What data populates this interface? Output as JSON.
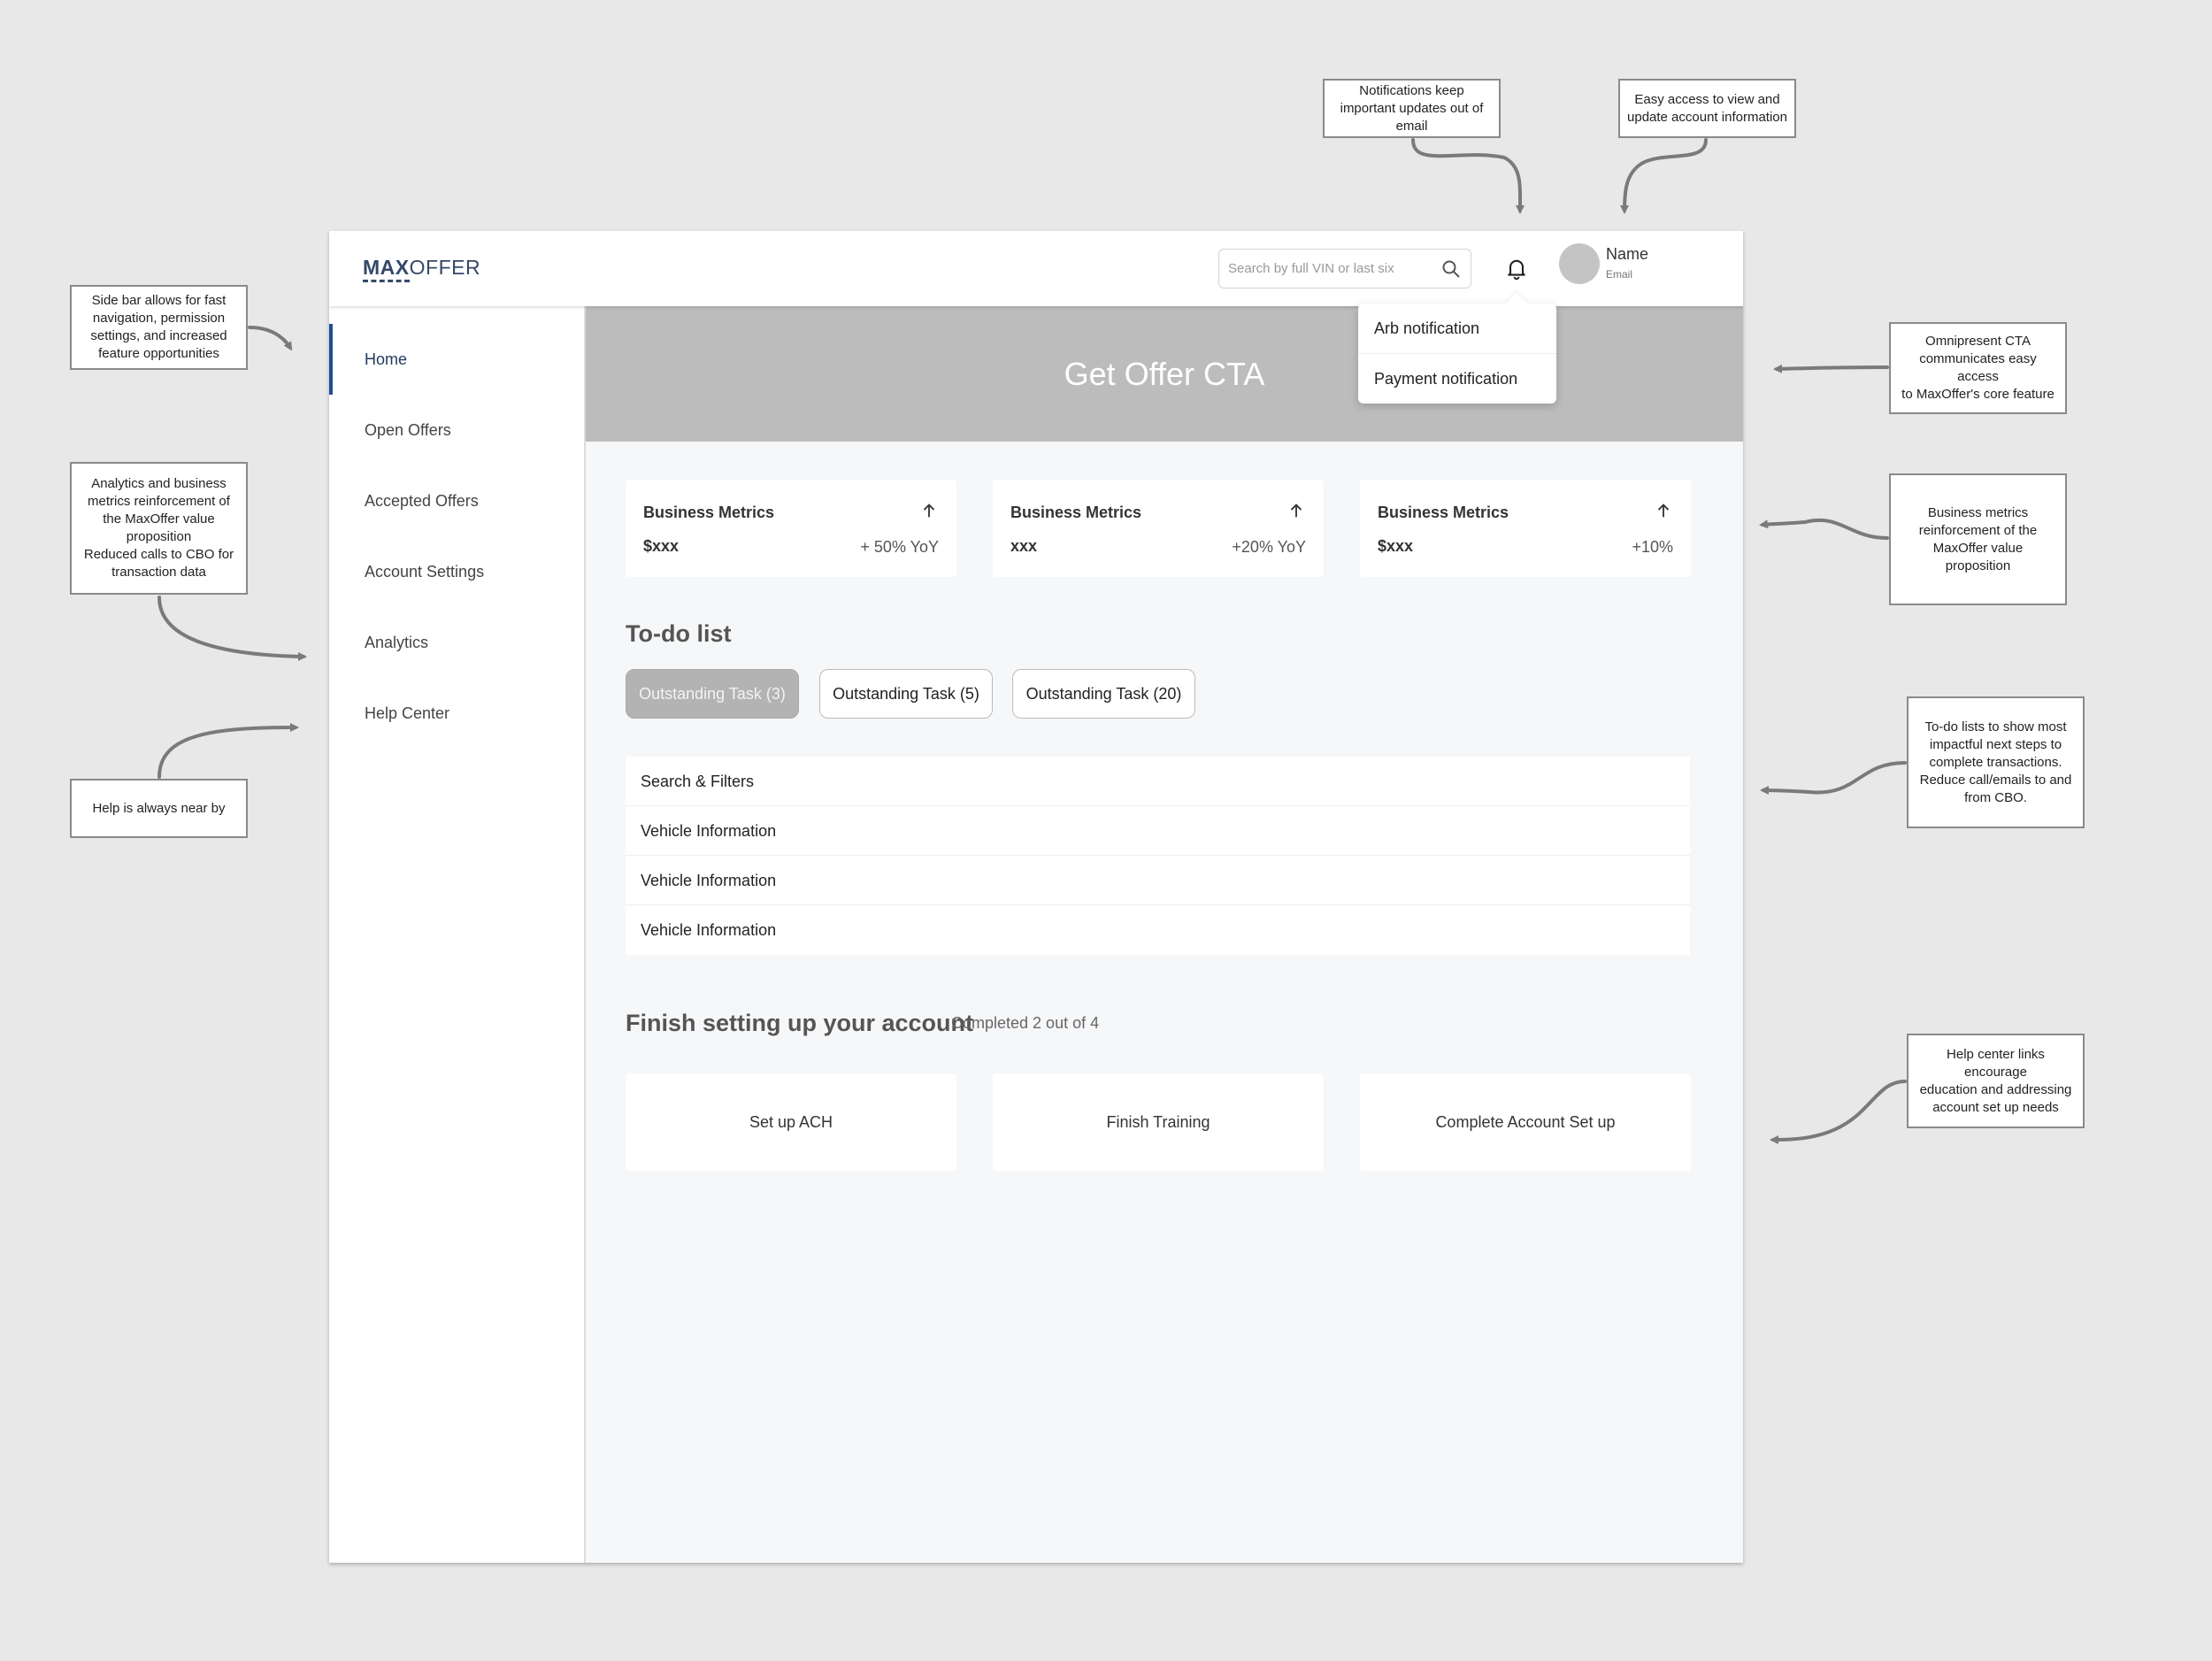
{
  "annotations": {
    "notifications": "Notifications keep\nimportant updates out of\nemail",
    "account": "Easy access to view and\nupdate account information",
    "sidebar": "Side bar allows for fast\nnavigation, permission\nsettings, and increased\nfeature opportunities",
    "analytics": "Analytics and business\nmetrics reinforcement of\nthe MaxOffer value\nproposition\nReduced calls to CBO for\ntransaction data",
    "help": "Help is always near by",
    "cta": "Omnipresent CTA\ncommunicates easy access\nto MaxOffer's core feature",
    "metrics": "Business metrics\nreinforcement of the\nMaxOffer value\nproposition",
    "todo": "To-do lists to show most\nimpactful next steps to\ncomplete transactions.\nReduce call/emails to and\nfrom CBO.",
    "helpcenter": "Help center links encourage\neducation and addressing\naccount set up needs"
  },
  "header": {
    "logo_bold": "MAX",
    "logo_light": "OFFER",
    "search_placeholder": "Search by full VIN or last six",
    "user_name": "Name",
    "user_email": "Email"
  },
  "notifications": [
    "Arb notification",
    "Payment notification"
  ],
  "sidebar": {
    "items": [
      {
        "label": "Home"
      },
      {
        "label": "Open Offers"
      },
      {
        "label": "Accepted Offers"
      },
      {
        "label": "Account Settings"
      },
      {
        "label": "Analytics"
      },
      {
        "label": "Help Center"
      }
    ]
  },
  "cta": {
    "label": "Get Offer CTA"
  },
  "metrics": [
    {
      "title": "Business Metrics",
      "value": "$xxx",
      "change": "+ 50% YoY"
    },
    {
      "title": "Business Metrics",
      "value": "xxx",
      "change": "+20% YoY"
    },
    {
      "title": "Business Metrics",
      "value": "$xxx",
      "change": "+10%"
    }
  ],
  "todo": {
    "title": "To-do list",
    "chips": [
      "Outstanding Task (3)",
      "Outstanding Task (5)",
      "Outstanding Task (20)"
    ],
    "tasks": [
      "Search & Filters",
      "Vehicle Information",
      "Vehicle Information",
      "Vehicle Information"
    ]
  },
  "setup": {
    "title": "Finish setting up your account",
    "progress": "Completed 2 out of 4",
    "cards": [
      "Set up ACH",
      "Finish Training",
      "Complete Account Set up"
    ]
  }
}
